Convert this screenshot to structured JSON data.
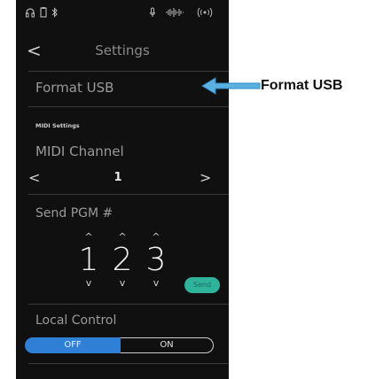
{
  "status_bar": {
    "icons": [
      "headphones-icon",
      "usb-icon",
      "bluetooth-icon",
      "microphone-icon",
      "audio-level-icon",
      "wireless-icon"
    ]
  },
  "nav": {
    "back_glyph": "<",
    "title": "Settings"
  },
  "menu": {
    "format_usb": "Format USB",
    "midi_section": "MIDI Settings",
    "midi_channel": {
      "label": "MIDI Channel",
      "prev_glyph": "<",
      "value": "1",
      "next_glyph": ">"
    },
    "send_pgm": {
      "label": "Send PGM #",
      "digits": [
        "1",
        "2",
        "3"
      ],
      "up_glyph": "^",
      "down_glyph": "v",
      "send_label": "Send"
    },
    "local_control": {
      "label": "Local Control",
      "off_label": "OFF",
      "on_label": "ON",
      "selected": "OFF"
    }
  },
  "callout": {
    "label": "Format USB"
  },
  "colors": {
    "screen_bg": "#101010",
    "accent_blue": "#2f7fd6",
    "send_green": "#2fb39a",
    "callout_arrow": "#4aa3d8"
  }
}
